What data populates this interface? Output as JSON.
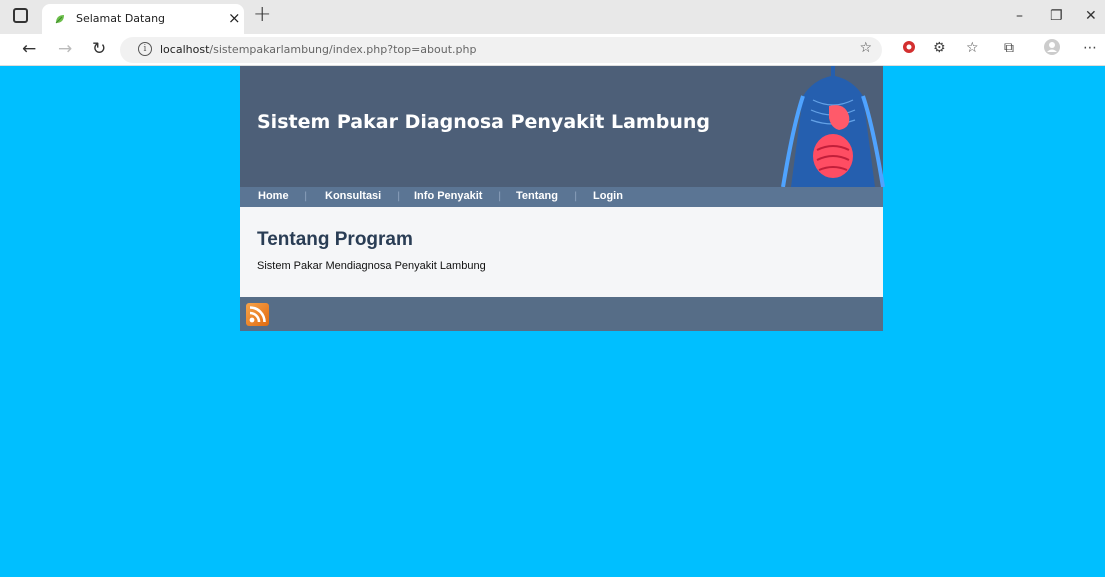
{
  "browser": {
    "tab_title": "Selamat Datang",
    "url_host": "localhost",
    "url_path": "/sistempakarlambung/index.php?top=about.php"
  },
  "site": {
    "title": "Sistem Pakar Diagnosa Penyakit Lambung",
    "nav": [
      "Home",
      "Konsultasi",
      "Info Penyakit",
      "Tentang",
      "Login"
    ],
    "section_heading": "Tentang Program",
    "section_text": "Sistem Pakar Mendiagnosa Penyakit Lambung"
  },
  "colors": {
    "page_background": "#00bfff",
    "header": "#4d5f78",
    "navbar": "#5b7594",
    "footer": "#566d87"
  }
}
